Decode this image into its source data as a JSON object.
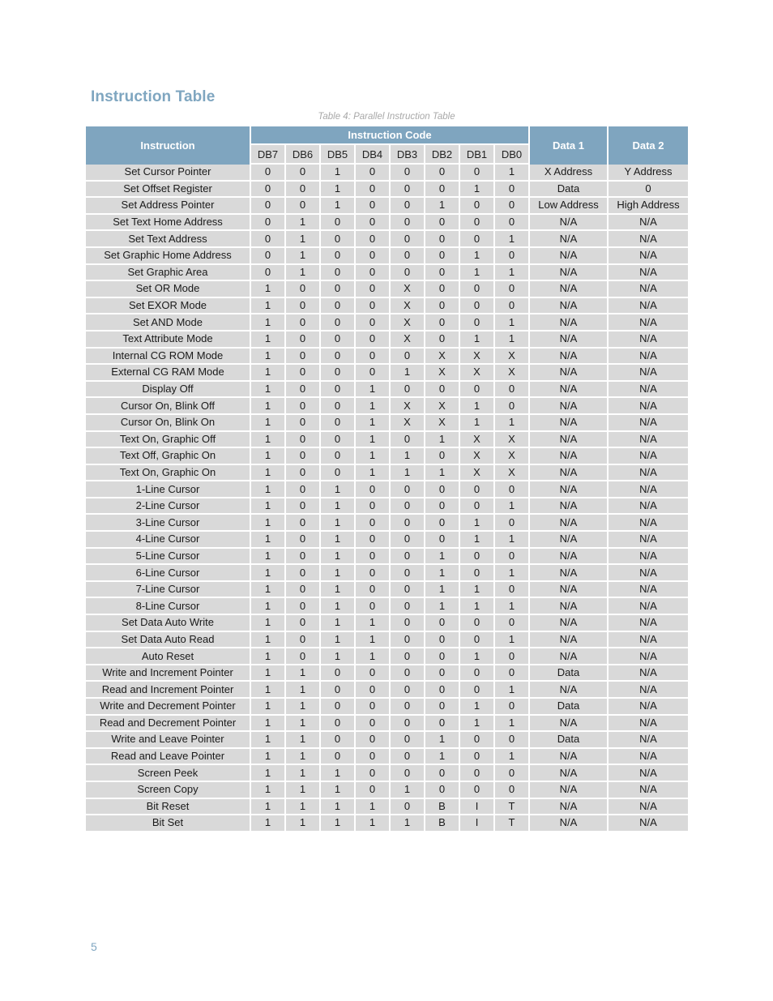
{
  "document": {
    "heading": "Instruction Table",
    "caption": "Table 4: Parallel Instruction Table",
    "page_number": "5"
  },
  "table": {
    "headers": {
      "instruction": "Instruction",
      "instruction_code": "Instruction Code",
      "bits": [
        "DB7",
        "DB6",
        "DB5",
        "DB4",
        "DB3",
        "DB2",
        "DB1",
        "DB0"
      ],
      "data1": "Data 1",
      "data2": "Data 2"
    },
    "rows": [
      {
        "name": "Set Cursor Pointer",
        "bits": [
          "0",
          "0",
          "1",
          "0",
          "0",
          "0",
          "0",
          "1"
        ],
        "data1": "X Address",
        "data2": "Y Address"
      },
      {
        "name": "Set Offset Register",
        "bits": [
          "0",
          "0",
          "1",
          "0",
          "0",
          "0",
          "1",
          "0"
        ],
        "data1": "Data",
        "data2": "0"
      },
      {
        "name": "Set Address Pointer",
        "bits": [
          "0",
          "0",
          "1",
          "0",
          "0",
          "1",
          "0",
          "0"
        ],
        "data1": "Low Address",
        "data2": "High Address"
      },
      {
        "name": "Set Text Home Address",
        "bits": [
          "0",
          "1",
          "0",
          "0",
          "0",
          "0",
          "0",
          "0"
        ],
        "data1": "N/A",
        "data2": "N/A"
      },
      {
        "name": "Set Text Address",
        "bits": [
          "0",
          "1",
          "0",
          "0",
          "0",
          "0",
          "0",
          "1"
        ],
        "data1": "N/A",
        "data2": "N/A"
      },
      {
        "name": "Set Graphic Home Address",
        "bits": [
          "0",
          "1",
          "0",
          "0",
          "0",
          "0",
          "1",
          "0"
        ],
        "data1": "N/A",
        "data2": "N/A"
      },
      {
        "name": "Set Graphic Area",
        "bits": [
          "0",
          "1",
          "0",
          "0",
          "0",
          "0",
          "1",
          "1"
        ],
        "data1": "N/A",
        "data2": "N/A"
      },
      {
        "name": "Set OR Mode",
        "bits": [
          "1",
          "0",
          "0",
          "0",
          "X",
          "0",
          "0",
          "0"
        ],
        "data1": "N/A",
        "data2": "N/A"
      },
      {
        "name": "Set EXOR Mode",
        "bits": [
          "1",
          "0",
          "0",
          "0",
          "X",
          "0",
          "0",
          "0"
        ],
        "data1": "N/A",
        "data2": "N/A"
      },
      {
        "name": "Set AND Mode",
        "bits": [
          "1",
          "0",
          "0",
          "0",
          "X",
          "0",
          "0",
          "1"
        ],
        "data1": "N/A",
        "data2": "N/A"
      },
      {
        "name": "Text Attribute Mode",
        "bits": [
          "1",
          "0",
          "0",
          "0",
          "X",
          "0",
          "1",
          "1"
        ],
        "data1": "N/A",
        "data2": "N/A"
      },
      {
        "name": "Internal CG ROM Mode",
        "bits": [
          "1",
          "0",
          "0",
          "0",
          "0",
          "X",
          "X",
          "X"
        ],
        "data1": "N/A",
        "data2": "N/A"
      },
      {
        "name": "External CG RAM Mode",
        "bits": [
          "1",
          "0",
          "0",
          "0",
          "1",
          "X",
          "X",
          "X"
        ],
        "data1": "N/A",
        "data2": "N/A"
      },
      {
        "name": "Display Off",
        "bits": [
          "1",
          "0",
          "0",
          "1",
          "0",
          "0",
          "0",
          "0"
        ],
        "data1": "N/A",
        "data2": "N/A"
      },
      {
        "name": "Cursor On, Blink Off",
        "bits": [
          "1",
          "0",
          "0",
          "1",
          "X",
          "X",
          "1",
          "0"
        ],
        "data1": "N/A",
        "data2": "N/A"
      },
      {
        "name": "Cursor On, Blink On",
        "bits": [
          "1",
          "0",
          "0",
          "1",
          "X",
          "X",
          "1",
          "1"
        ],
        "data1": "N/A",
        "data2": "N/A"
      },
      {
        "name": "Text On, Graphic Off",
        "bits": [
          "1",
          "0",
          "0",
          "1",
          "0",
          "1",
          "X",
          "X"
        ],
        "data1": "N/A",
        "data2": "N/A"
      },
      {
        "name": "Text Off, Graphic On",
        "bits": [
          "1",
          "0",
          "0",
          "1",
          "1",
          "0",
          "X",
          "X"
        ],
        "data1": "N/A",
        "data2": "N/A"
      },
      {
        "name": "Text On, Graphic On",
        "bits": [
          "1",
          "0",
          "0",
          "1",
          "1",
          "1",
          "X",
          "X"
        ],
        "data1": "N/A",
        "data2": "N/A"
      },
      {
        "name": "1-Line Cursor",
        "bits": [
          "1",
          "0",
          "1",
          "0",
          "0",
          "0",
          "0",
          "0"
        ],
        "data1": "N/A",
        "data2": "N/A"
      },
      {
        "name": "2-Line Cursor",
        "bits": [
          "1",
          "0",
          "1",
          "0",
          "0",
          "0",
          "0",
          "1"
        ],
        "data1": "N/A",
        "data2": "N/A"
      },
      {
        "name": "3-Line Cursor",
        "bits": [
          "1",
          "0",
          "1",
          "0",
          "0",
          "0",
          "1",
          "0"
        ],
        "data1": "N/A",
        "data2": "N/A"
      },
      {
        "name": "4-Line Cursor",
        "bits": [
          "1",
          "0",
          "1",
          "0",
          "0",
          "0",
          "1",
          "1"
        ],
        "data1": "N/A",
        "data2": "N/A"
      },
      {
        "name": "5-Line Cursor",
        "bits": [
          "1",
          "0",
          "1",
          "0",
          "0",
          "1",
          "0",
          "0"
        ],
        "data1": "N/A",
        "data2": "N/A"
      },
      {
        "name": "6-Line Cursor",
        "bits": [
          "1",
          "0",
          "1",
          "0",
          "0",
          "1",
          "0",
          "1"
        ],
        "data1": "N/A",
        "data2": "N/A"
      },
      {
        "name": "7-Line Cursor",
        "bits": [
          "1",
          "0",
          "1",
          "0",
          "0",
          "1",
          "1",
          "0"
        ],
        "data1": "N/A",
        "data2": "N/A"
      },
      {
        "name": "8-Line Cursor",
        "bits": [
          "1",
          "0",
          "1",
          "0",
          "0",
          "1",
          "1",
          "1"
        ],
        "data1": "N/A",
        "data2": "N/A"
      },
      {
        "name": "Set Data Auto Write",
        "bits": [
          "1",
          "0",
          "1",
          "1",
          "0",
          "0",
          "0",
          "0"
        ],
        "data1": "N/A",
        "data2": "N/A"
      },
      {
        "name": "Set Data Auto Read",
        "bits": [
          "1",
          "0",
          "1",
          "1",
          "0",
          "0",
          "0",
          "1"
        ],
        "data1": "N/A",
        "data2": "N/A"
      },
      {
        "name": "Auto Reset",
        "bits": [
          "1",
          "0",
          "1",
          "1",
          "0",
          "0",
          "1",
          "0"
        ],
        "data1": "N/A",
        "data2": "N/A"
      },
      {
        "name": "Write and Increment Pointer",
        "bits": [
          "1",
          "1",
          "0",
          "0",
          "0",
          "0",
          "0",
          "0"
        ],
        "data1": "Data",
        "data2": "N/A"
      },
      {
        "name": "Read and Increment Pointer",
        "bits": [
          "1",
          "1",
          "0",
          "0",
          "0",
          "0",
          "0",
          "1"
        ],
        "data1": "N/A",
        "data2": "N/A"
      },
      {
        "name": "Write and Decrement Pointer",
        "bits": [
          "1",
          "1",
          "0",
          "0",
          "0",
          "0",
          "1",
          "0"
        ],
        "data1": "Data",
        "data2": "N/A"
      },
      {
        "name": "Read and Decrement Pointer",
        "bits": [
          "1",
          "1",
          "0",
          "0",
          "0",
          "0",
          "1",
          "1"
        ],
        "data1": "N/A",
        "data2": "N/A"
      },
      {
        "name": "Write and Leave Pointer",
        "bits": [
          "1",
          "1",
          "0",
          "0",
          "0",
          "1",
          "0",
          "0"
        ],
        "data1": "Data",
        "data2": "N/A"
      },
      {
        "name": "Read and Leave Pointer",
        "bits": [
          "1",
          "1",
          "0",
          "0",
          "0",
          "1",
          "0",
          "1"
        ],
        "data1": "N/A",
        "data2": "N/A"
      },
      {
        "name": "Screen Peek",
        "bits": [
          "1",
          "1",
          "1",
          "0",
          "0",
          "0",
          "0",
          "0"
        ],
        "data1": "N/A",
        "data2": "N/A"
      },
      {
        "name": "Screen Copy",
        "bits": [
          "1",
          "1",
          "1",
          "0",
          "1",
          "0",
          "0",
          "0"
        ],
        "data1": "N/A",
        "data2": "N/A"
      },
      {
        "name": "Bit Reset",
        "bits": [
          "1",
          "1",
          "1",
          "1",
          "0",
          "B",
          "I",
          "T"
        ],
        "data1": "N/A",
        "data2": "N/A"
      },
      {
        "name": "Bit Set",
        "bits": [
          "1",
          "1",
          "1",
          "1",
          "1",
          "B",
          "I",
          "T"
        ],
        "data1": "N/A",
        "data2": "N/A"
      }
    ]
  }
}
